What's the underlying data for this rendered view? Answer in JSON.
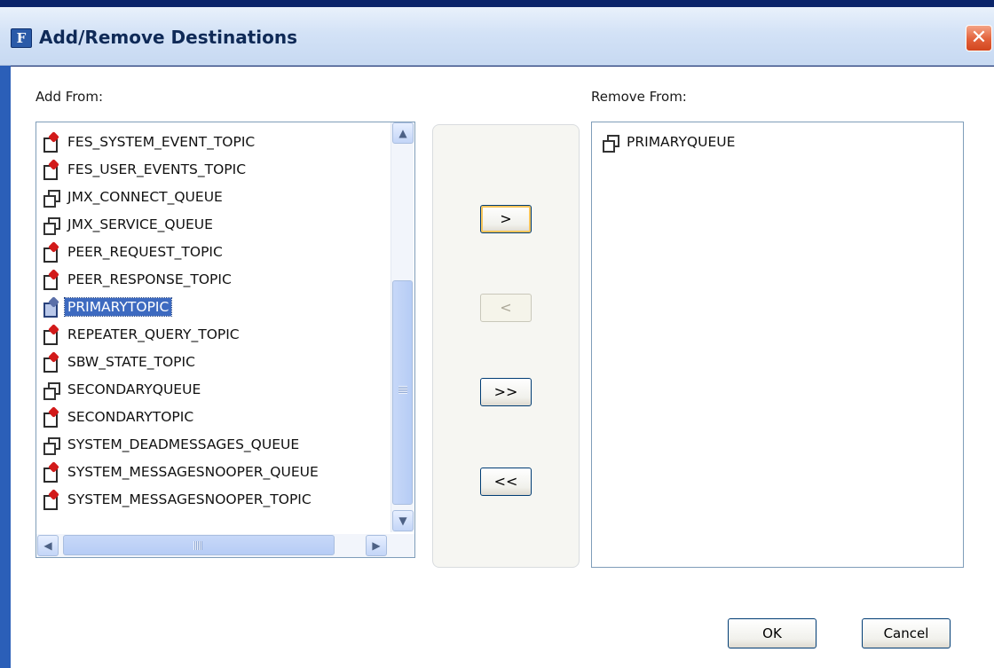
{
  "window": {
    "title": "Add/Remove Destinations",
    "close_glyph": "✕",
    "app_icon_glyph": "F"
  },
  "add_from": {
    "label": "Add From:",
    "items": [
      {
        "name": "FES_SYSTEM_EVENT_TOPIC",
        "type": "topic",
        "selected": false
      },
      {
        "name": "FES_USER_EVENTS_TOPIC",
        "type": "topic",
        "selected": false
      },
      {
        "name": "JMX_CONNECT_QUEUE",
        "type": "queue",
        "selected": false
      },
      {
        "name": "JMX_SERVICE_QUEUE",
        "type": "queue",
        "selected": false
      },
      {
        "name": "PEER_REQUEST_TOPIC",
        "type": "topic",
        "selected": false
      },
      {
        "name": "PEER_RESPONSE_TOPIC",
        "type": "topic",
        "selected": false
      },
      {
        "name": "PRIMARYTOPIC",
        "type": "topic",
        "selected": true
      },
      {
        "name": "REPEATER_QUERY_TOPIC",
        "type": "topic",
        "selected": false
      },
      {
        "name": "SBW_STATE_TOPIC",
        "type": "topic",
        "selected": false
      },
      {
        "name": "SECONDARYQUEUE",
        "type": "queue",
        "selected": false
      },
      {
        "name": "SECONDARYTOPIC",
        "type": "topic",
        "selected": false
      },
      {
        "name": "SYSTEM_DEADMESSAGES_QUEUE",
        "type": "queue",
        "selected": false
      },
      {
        "name": "SYSTEM_MESSAGESNOOPER_QUEUE",
        "type": "topic",
        "selected": false
      },
      {
        "name": "SYSTEM_MESSAGESNOOPER_TOPIC",
        "type": "topic",
        "selected": false
      }
    ]
  },
  "remove_from": {
    "label": "Remove From:",
    "items": [
      {
        "name": "PRIMARYQUEUE",
        "type": "queue",
        "selected": false
      }
    ]
  },
  "move_buttons": {
    "add": ">",
    "remove": "<",
    "add_all": ">>",
    "remove_all": "<<"
  },
  "scroll_glyphs": {
    "up": "▲",
    "down": "▼",
    "left": "◀",
    "right": "▶"
  },
  "dialog_buttons": {
    "ok": "OK",
    "cancel": "Cancel"
  },
  "colors": {
    "selection": "#3d6ac0",
    "title_text": "#0f2a57",
    "close_button": "#e2613a"
  },
  "icons": {
    "topic": "topic-icon",
    "queue": "queue-icon"
  }
}
